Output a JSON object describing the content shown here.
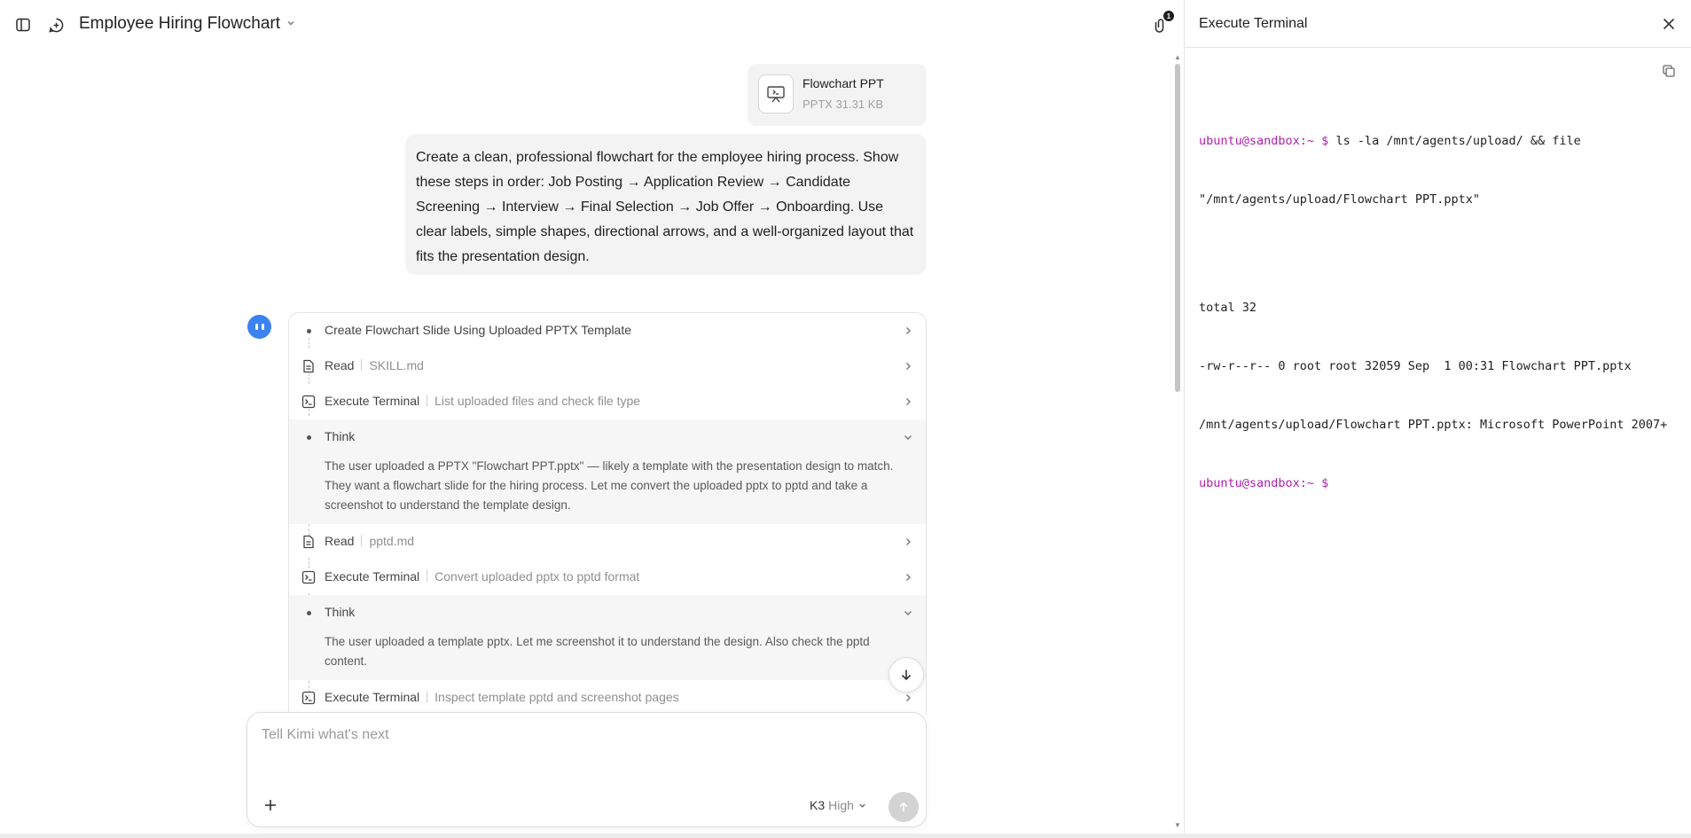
{
  "header": {
    "title": "Employee Hiring Flowchart",
    "attachment_count": "1"
  },
  "attachment": {
    "name": "Flowchart PPT",
    "meta": "PPTX 31.31 KB"
  },
  "user_message": "Create a clean, professional flowchart for the employee hiring process. Show these steps in order: Job Posting → Application Review → Candidate Screening → Interview → Final Selection → Job Offer → Onboarding. Use clear labels, simple shapes, directional arrows, and a well-organized layout that fits the presentation design.",
  "steps": [
    {
      "icon": "bullet",
      "label": "Create Flowchart Slide Using Uploaded PPTX Template",
      "sub": ""
    },
    {
      "icon": "file-icon",
      "label": "Read",
      "sub": "SKILL.md"
    },
    {
      "icon": "terminal-icon",
      "label": "Execute Terminal",
      "sub": "List uploaded files and check file type"
    },
    {
      "icon": "bullet",
      "label": "Think",
      "sub": "",
      "body": "The user uploaded a PPTX \"Flowchart PPT.pptx\" — likely a template with the presentation design to match. They want a flowchart slide for the hiring process. Let me convert the uploaded pptx to pptd and take a screenshot to understand the template design."
    },
    {
      "icon": "file-icon",
      "label": "Read",
      "sub": "pptd.md"
    },
    {
      "icon": "terminal-icon",
      "label": "Execute Terminal",
      "sub": "Convert uploaded pptx to pptd format"
    },
    {
      "icon": "bullet",
      "label": "Think",
      "sub": "",
      "body": "The user uploaded a template pptx. Let me screenshot it to understand the design. Also check the pptd content."
    },
    {
      "icon": "terminal-icon",
      "label": "Execute Terminal",
      "sub": "Inspect template pptd and screenshot pages"
    }
  ],
  "composer": {
    "placeholder": "Tell Kimi what's next",
    "model": "K3",
    "mode": "High"
  },
  "panel": {
    "title": "Execute Terminal",
    "terminal": {
      "prompt": "ubuntu@sandbox:~ $",
      "command_line1": " ls -la /mnt/agents/upload/ && file",
      "command_line2": "\"/mnt/agents/upload/Flowchart PPT.pptx\"",
      "out1": "total 32",
      "out2": "-rw-r--r-- 0 root root 32059 Sep  1 00:31 Flowchart PPT.pptx",
      "out3": "/mnt/agents/upload/Flowchart PPT.pptx: Microsoft PowerPoint 2007+",
      "final_prompt": "ubuntu@sandbox:~ $"
    }
  }
}
